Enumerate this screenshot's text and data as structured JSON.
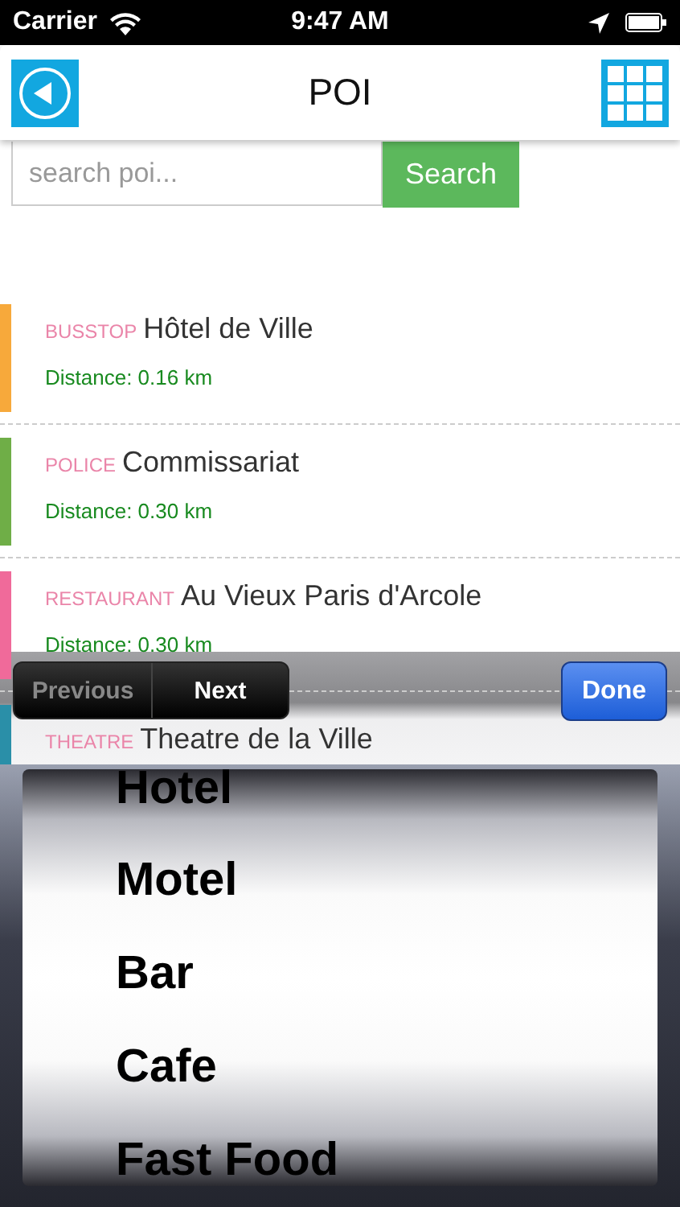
{
  "status_bar": {
    "carrier": "Carrier",
    "time": "9:47 AM"
  },
  "nav": {
    "title": "POI"
  },
  "search": {
    "placeholder": "search poi...",
    "button": "Search"
  },
  "pois": [
    {
      "category": "BUSSTOP",
      "name": "Hôtel de Ville",
      "distance": "Distance: 0.16 km",
      "color": "#f7a93b"
    },
    {
      "category": "POLICE",
      "name": "Commissariat",
      "distance": "Distance: 0.30 km",
      "color": "#6fae47"
    },
    {
      "category": "RESTAURANT",
      "name": "Au Vieux Paris d'Arcole",
      "distance": "Distance: 0.30 km",
      "color": "#f06a9a"
    },
    {
      "category": "THEATRE",
      "name": "Theatre de la Ville",
      "color": "#2a8fa8"
    }
  ],
  "keyboard_toolbar": {
    "nav_buttons": [
      {
        "label": "Previous",
        "disabled": true
      },
      {
        "label": "Next",
        "disabled": false
      }
    ],
    "done": "Done"
  },
  "picker": {
    "options": [
      "Hotel",
      "Motel",
      "Bar",
      "Cafe",
      "Fast Food"
    ]
  }
}
